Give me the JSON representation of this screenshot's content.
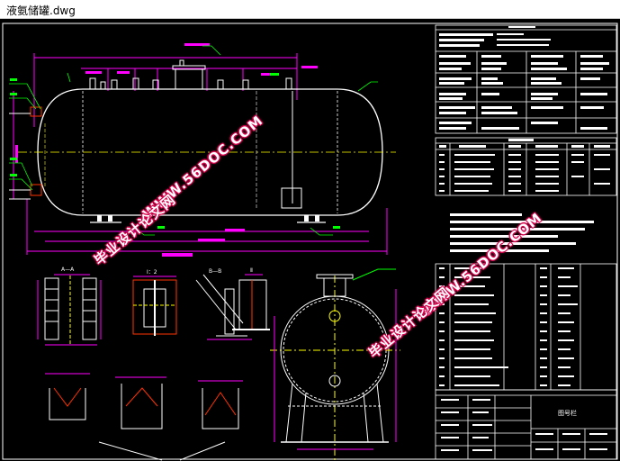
{
  "window": {
    "title": "液氨储罐.dwg"
  },
  "watermarks": {
    "url_text": "WWW.56DOC.COM",
    "cn_text": "毕业设计论文网"
  },
  "drawing": {
    "title_block_label": "图号栏",
    "detail_label_1": "I：2",
    "detail_label_2": "A—A",
    "detail_label_3": "B—B",
    "detail_label_4": "Ⅱ"
  },
  "colors": {
    "background": "#000000",
    "dimension": "#ff00ff",
    "outline": "#ffffff",
    "centerline": "#ffff00",
    "leader": "#00ff00",
    "section": "#ff3300",
    "watermark_stroke": "#d6004a"
  }
}
